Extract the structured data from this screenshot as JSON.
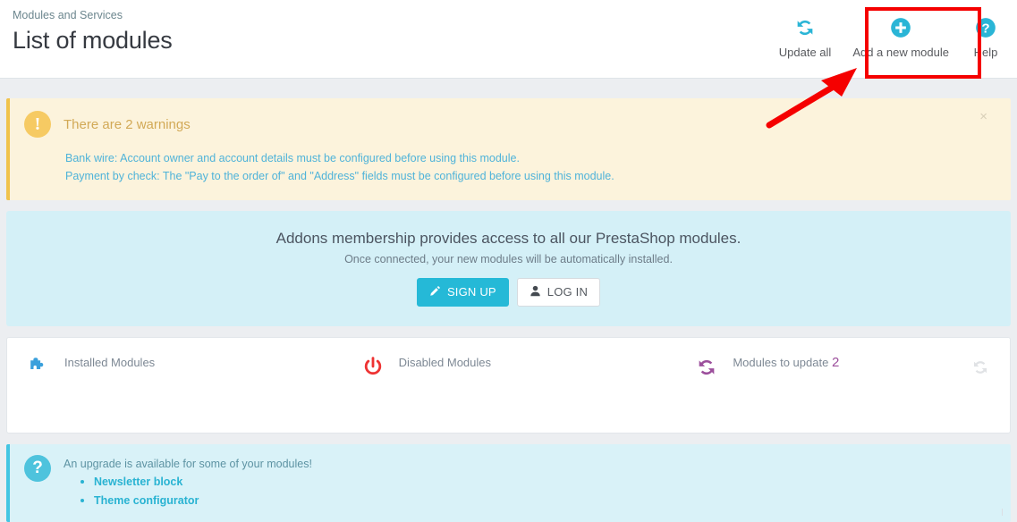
{
  "header": {
    "breadcrumb": "Modules and Services",
    "title": "List of modules"
  },
  "toolbar": {
    "items": [
      {
        "label": "Update all",
        "icon": "refresh-icon",
        "name": "update-all"
      },
      {
        "label": "Add a new module",
        "icon": "plus-circle-icon",
        "name": "add-new-module"
      },
      {
        "label": "Help",
        "icon": "help-circle-icon",
        "name": "help"
      }
    ]
  },
  "annotation": {
    "highlight_color": "#f50000",
    "target_label": "Add a new module"
  },
  "warning_alert": {
    "icon": "warning-exclamation-icon",
    "title": "There are 2 warnings",
    "lines": [
      "Bank wire: Account owner and account details must be configured before using this module.",
      "Payment by check: The \"Pay to the order of\" and \"Address\" fields must be configured before using this module."
    ],
    "close_label": "×",
    "accent_color": "#f0c34c"
  },
  "addons": {
    "title": "Addons membership provides access to all our PrestaShop modules.",
    "subtitle": "Once connected, your new modules will be automatically installed.",
    "signup_label": "SIGN UP",
    "signup_icon": "pencil-icon",
    "login_label": "LOG IN",
    "login_icon": "user-icon",
    "accent_color": "#25b9d7"
  },
  "stats": {
    "items": [
      {
        "label": "Installed Modules",
        "value": "",
        "icon": "puzzle-piece-icon",
        "color": "#3aa0dc"
      },
      {
        "label": "Disabled Modules",
        "value": "",
        "icon": "power-off-icon",
        "color": "#ee3333"
      },
      {
        "label": "Modules to update",
        "value": "2",
        "icon": "refresh-icon",
        "color": "#9c4f9c"
      }
    ],
    "refresh_icon": "refresh-icon"
  },
  "info_alert": {
    "icon": "question-circle-icon",
    "title": "An upgrade is available for some of your modules!",
    "links": [
      "Newsletter block",
      "Theme configurator"
    ],
    "accent_color": "#44c5e2"
  }
}
